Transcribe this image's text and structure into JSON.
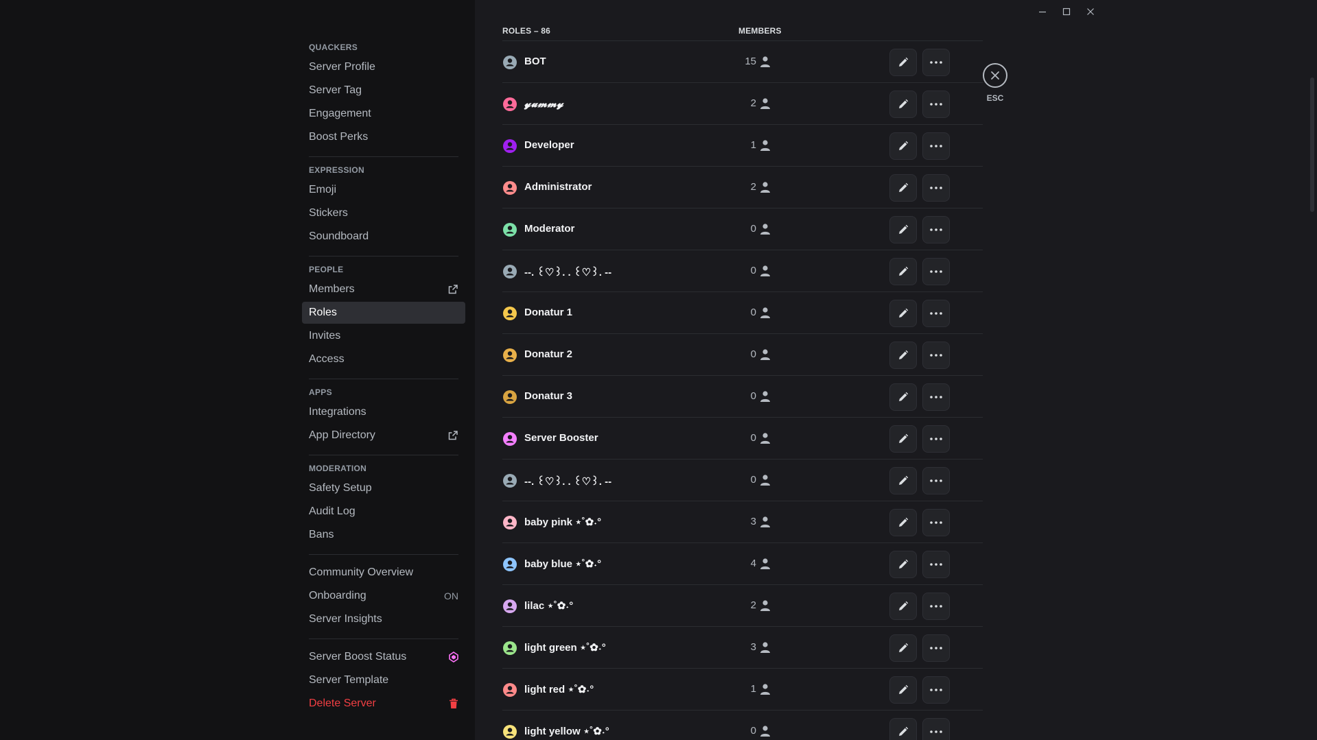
{
  "sidebar": {
    "sections": [
      {
        "header": "QUACKERS",
        "items": [
          {
            "label": "Server Profile"
          },
          {
            "label": "Server Tag"
          },
          {
            "label": "Engagement"
          },
          {
            "label": "Boost Perks"
          }
        ]
      },
      {
        "header": "EXPRESSION",
        "items": [
          {
            "label": "Emoji"
          },
          {
            "label": "Stickers"
          },
          {
            "label": "Soundboard"
          }
        ]
      },
      {
        "header": "PEOPLE",
        "items": [
          {
            "label": "Members",
            "icon": "external-link-icon"
          },
          {
            "label": "Roles",
            "active": true
          },
          {
            "label": "Invites"
          },
          {
            "label": "Access"
          }
        ]
      },
      {
        "header": "APPS",
        "items": [
          {
            "label": "Integrations"
          },
          {
            "label": "App Directory",
            "icon": "external-link-icon"
          }
        ]
      },
      {
        "header": "MODERATION",
        "items": [
          {
            "label": "Safety Setup"
          },
          {
            "label": "Audit Log"
          },
          {
            "label": "Bans"
          }
        ]
      },
      {
        "header": "",
        "items": [
          {
            "label": "Community Overview"
          },
          {
            "label": "Onboarding",
            "badge": "ON"
          },
          {
            "label": "Server Insights"
          }
        ]
      },
      {
        "header": "",
        "items": [
          {
            "label": "Server Boost Status",
            "icon": "boost-gem-icon"
          },
          {
            "label": "Server Template"
          },
          {
            "label": "Delete Server",
            "icon": "trash-icon",
            "danger": true
          }
        ]
      }
    ]
  },
  "roles_table": {
    "roles_header": "ROLES – 86",
    "members_header": "MEMBERS",
    "rows": [
      {
        "name": "BOT",
        "count": "15",
        "color": "#99aab5"
      },
      {
        "name": "𝔂𝓾𝓶𝓶𝔂",
        "count": "2",
        "color": "#ff6b9a",
        "style": "script"
      },
      {
        "name": "Developer",
        "count": "1",
        "color": "#a020f0"
      },
      {
        "name": "Administrator",
        "count": "2",
        "color": "#ff8c8c"
      },
      {
        "name": "Moderator",
        "count": "0",
        "color": "#7ce0a8"
      },
      {
        "name": "--. ꒰♡꒱. . ꒰♡꒱. --",
        "count": "0",
        "color": "#99aab5"
      },
      {
        "name": "Donatur 1",
        "count": "0",
        "color": "#f5c84c"
      },
      {
        "name": "Donatur 2",
        "count": "0",
        "color": "#e8b04a"
      },
      {
        "name": "Donatur 3",
        "count": "0",
        "color": "#d9a441"
      },
      {
        "name": "Server Booster",
        "count": "0",
        "color": "#f47fff"
      },
      {
        "name": "--. ꒰♡꒱. . ꒰♡꒱. --",
        "count": "0",
        "color": "#99aab5"
      },
      {
        "name": "baby pink ⋆˚✿˖°",
        "count": "3",
        "color": "#ffb6c8"
      },
      {
        "name": "baby blue ⋆˚✿˖°",
        "count": "4",
        "color": "#8ec5ff"
      },
      {
        "name": "lilac ⋆˚✿˖°",
        "count": "2",
        "color": "#d7a8f0"
      },
      {
        "name": "light green ⋆˚✿˖°",
        "count": "3",
        "color": "#9be58b"
      },
      {
        "name": "light red ⋆˚✿˖°",
        "count": "1",
        "color": "#ff8a8a"
      },
      {
        "name": "light yellow ⋆˚✿˖°",
        "count": "0",
        "color": "#f7e27a"
      }
    ]
  },
  "close": {
    "label": "ESC"
  },
  "colors": {
    "accent": "#5865f2",
    "danger": "#f23f43",
    "boost": "#ff73fa"
  }
}
